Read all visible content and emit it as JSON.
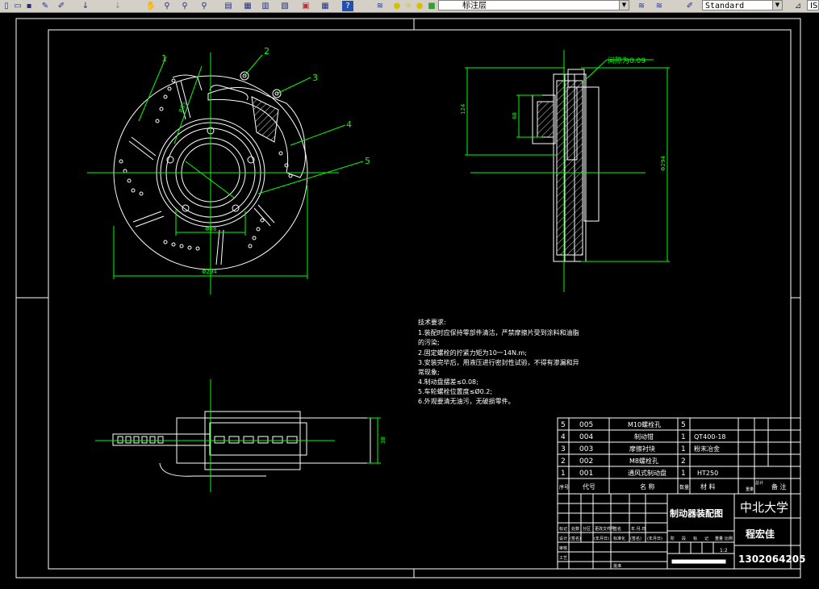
{
  "toolbar": {
    "layer_name": "标注层",
    "style_name": "Standard",
    "right_label": "IS"
  },
  "drawing": {
    "leader_labels": [
      "1",
      "2",
      "3",
      "4",
      "5"
    ],
    "gap_note": "间隙为0.09",
    "dim_124": "124",
    "dim_68": "68",
    "dim_right_vertical": "Φ294",
    "dim_left_bottom": "Φ294",
    "dim_left_inner": "Φ88",
    "dim_left_aux": "R65",
    "dim_bottom_right": "38",
    "tech_title": "技术要求:",
    "tech_lines": [
      "1.装配时应保持零部件清洁，严禁摩擦片受到涂料和油脂",
      "的污染;",
      "2.固定螺栓的拧紧力矩为10一14N.m;",
      "3.安装完毕后，用液压进行密封性试验，不得有渗漏和异",
      "常现象;",
      "4.制动盘摆差≤0.08;",
      "5.车轮螺栓位置度≤Ø0.2;",
      "6.外观要清无油污，无破损零件。"
    ]
  },
  "bom": {
    "rows": [
      {
        "seq": "5",
        "code": "005",
        "name": "M10螺栓孔",
        "qty": "5",
        "material": ""
      },
      {
        "seq": "4",
        "code": "004",
        "name": "制动钳",
        "qty": "1",
        "material": "QT400-18"
      },
      {
        "seq": "3",
        "code": "003",
        "name": "摩擦衬块",
        "qty": "1",
        "material": "粉末冶金"
      },
      {
        "seq": "2",
        "code": "002",
        "name": "M8螺栓孔",
        "qty": "2",
        "material": ""
      },
      {
        "seq": "1",
        "code": "001",
        "name": "通风式制动盘",
        "qty": "1",
        "material": "HT250"
      }
    ],
    "header": {
      "seq": "序号",
      "code": "代号",
      "name": "名 称",
      "qty": "数量",
      "material": "材 料",
      "total": "总计",
      "note": "备 注",
      "weight": "重量"
    }
  },
  "title_block": {
    "drawing_title": "制动器装配图",
    "school": "中北大学",
    "author": "程宏佳",
    "student_id": "1302064205",
    "scale": "1:2",
    "row_labels": [
      "标记",
      "处数",
      "分区",
      "更改文件号",
      "签名",
      "年.月.日"
    ],
    "design_labels": [
      "设计",
      "(签名)",
      "(年月日)",
      "标准化",
      "(签名)",
      "(年月日)"
    ],
    "stage_labels": [
      "阶",
      "段",
      "标",
      "记",
      "重量",
      "比例"
    ],
    "left_labels": [
      "审核",
      "工艺",
      "批准"
    ]
  }
}
